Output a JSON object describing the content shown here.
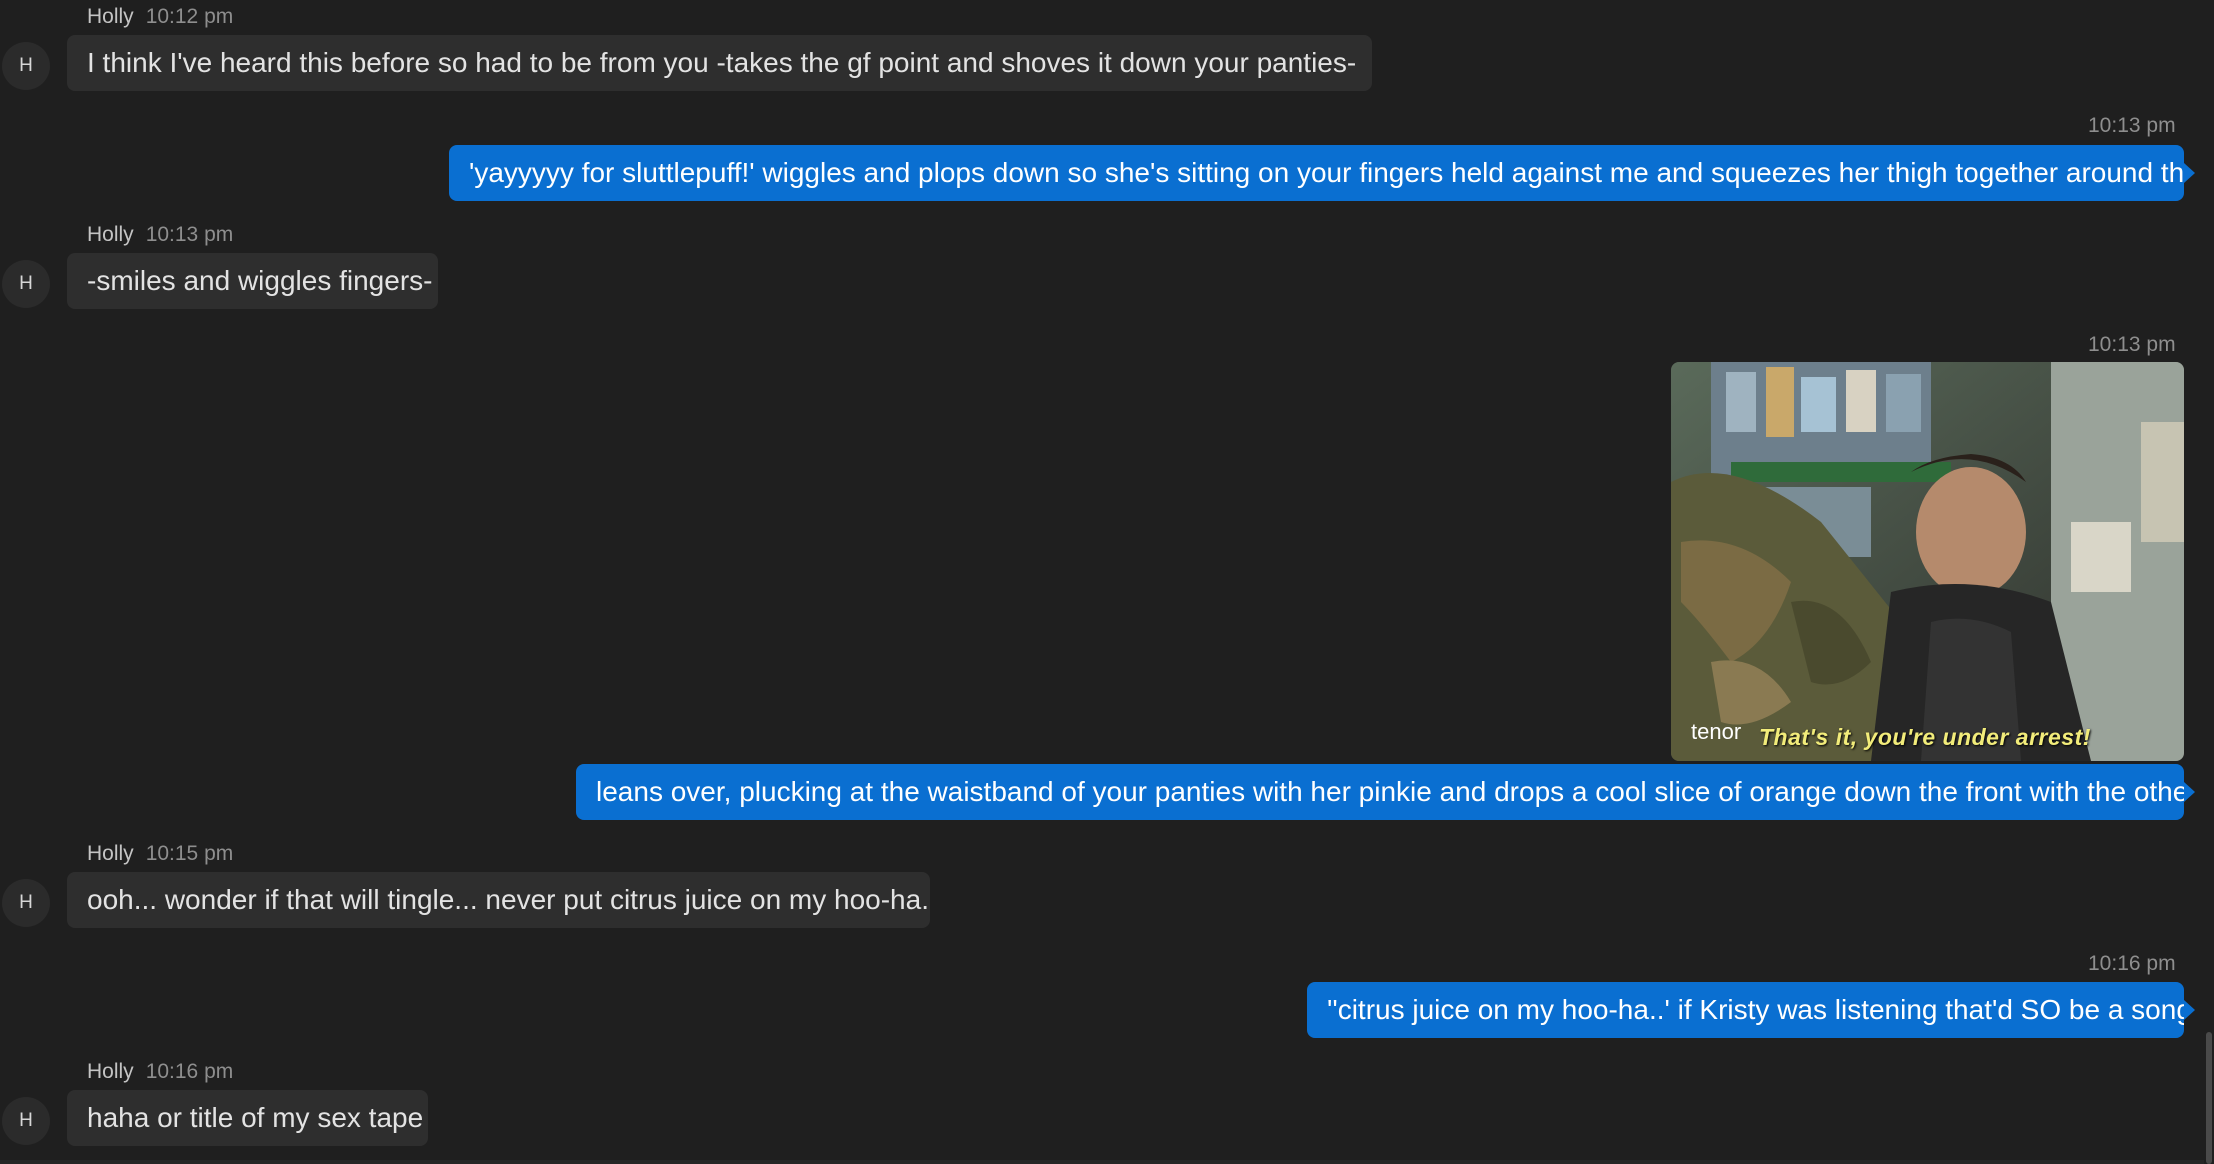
{
  "messages": [
    {
      "sender": "Holly",
      "time": "10:12 pm",
      "avatar_initial": "H",
      "text": "I think I've heard this before so had to be from you -takes the gf point and shoves it down your panties-",
      "emoji": "smiley-face-icon"
    },
    {
      "time": "10:13 pm",
      "text": "'yayyyyy for sluttlepuff!' wiggles and plops down so she's sitting on your fingers held against me and squeezes her thigh together around them.."
    },
    {
      "sender": "Holly",
      "time": "10:13 pm",
      "avatar_initial": "H",
      "text": "-smiles and wiggles fingers-"
    },
    {
      "time": "10:13 pm",
      "gif": {
        "brand": "tenor",
        "caption": "That's it, you're under arrest!"
      },
      "text": "leans over, plucking at the waistband of your panties with her pinkie and drops a cool slice of orange down the front with the others.."
    },
    {
      "sender": "Holly",
      "time": "10:15 pm",
      "avatar_initial": "H",
      "text": "ooh... wonder if that will tingle... never put citrus juice on my hoo-ha..."
    },
    {
      "time": "10:16 pm",
      "text": "''citrus juice on my hoo-ha..' if Kristy was listening that'd SO be a song!'"
    },
    {
      "sender": "Holly",
      "time": "10:16 pm",
      "avatar_initial": "H",
      "text": "haha or title of my sex tape"
    }
  ],
  "colors": {
    "background": "#1f1f1f",
    "incoming_bubble": "#2e2e2e",
    "outgoing_bubble": "#0a6fd1",
    "meta_text": "#8e8e8e"
  }
}
